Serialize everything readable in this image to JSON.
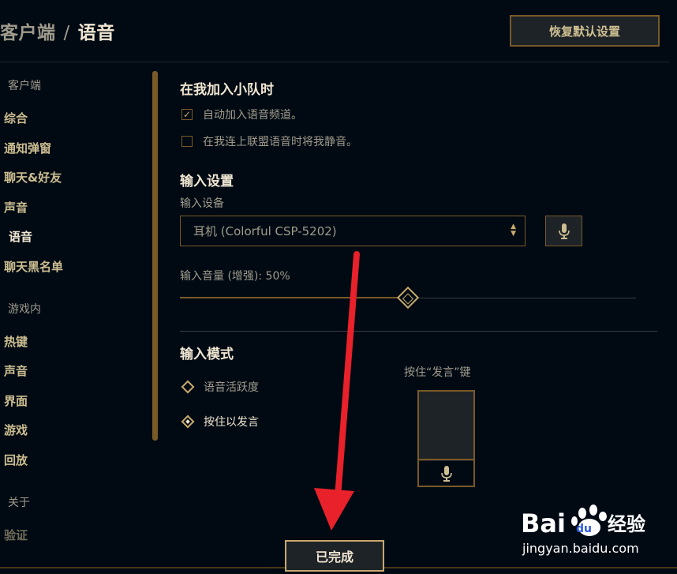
{
  "header": {
    "parent": "客户端",
    "separator": "/",
    "current": "语音",
    "reset_label": "恢复默认设置"
  },
  "sidebar": {
    "groups": [
      {
        "label": "客户端",
        "items": [
          "综合",
          "通知弹窗",
          "聊天&好友",
          "声音",
          "语音",
          "聊天黑名单"
        ]
      },
      {
        "label": "游戏内",
        "items": [
          "热键",
          "声音",
          "界面",
          "游戏",
          "回放"
        ]
      },
      {
        "label": "关于",
        "items": [
          "验证"
        ]
      }
    ],
    "active": "语音"
  },
  "party": {
    "title": "在我加入小队时",
    "auto_join_label": "自动加入语音频道。",
    "auto_join_checked": true,
    "mute_label": "在我连上联盟语音时将我静音。",
    "mute_checked": false
  },
  "input_settings": {
    "title": "输入设置",
    "device_label": "输入设备",
    "device_value": "耳机 (Colorful CSP-5202)",
    "volume_label": "输入音量 (增强): 50%",
    "volume_percent": 50
  },
  "input_mode": {
    "title": "输入模式",
    "options": [
      "语音活跃度",
      "按住以发言"
    ],
    "selected": "按住以发言",
    "ptt_label": "按住“发言”键"
  },
  "footer": {
    "done_label": "已完成"
  },
  "watermark": {
    "brand_latin": "Bai",
    "brand_latin2": "du",
    "brand_cn": "经验",
    "url": "jingyan.baidu.com"
  },
  "colors": {
    "background": "#010a13",
    "gold": "#c8aa6e",
    "gold_dark": "#785a28",
    "text_light": "#f0e6d2",
    "text_muted": "#a09b8c",
    "annotation_arrow": "#e8212b"
  },
  "icons": {
    "check": "checkmark-icon",
    "mic": "microphone-icon",
    "select_chevron": "updown-chevron-icon"
  }
}
